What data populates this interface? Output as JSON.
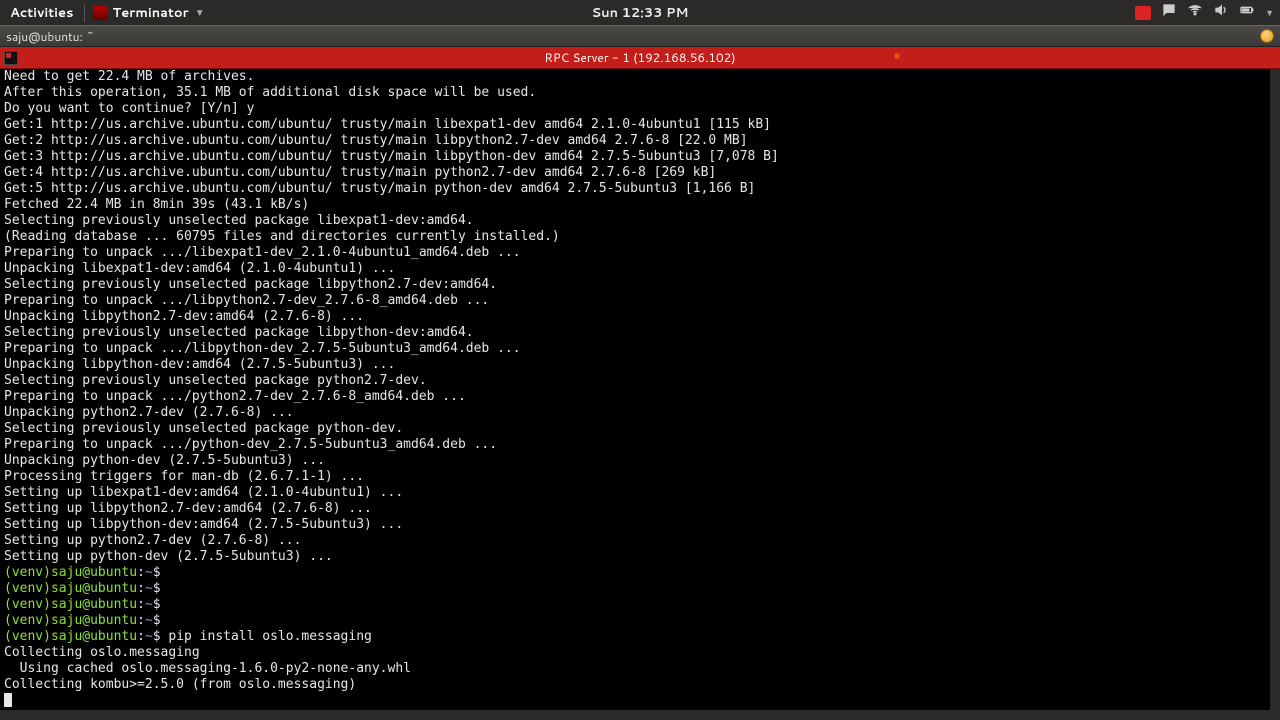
{
  "topbar": {
    "activities": "Activities",
    "app_name": "Terminator",
    "clock": "Sun 12:33 PM"
  },
  "window": {
    "title": "saju@ubuntu: ~"
  },
  "terminator_tab": {
    "title": "RPC Server - 1 (192.168.56.102)"
  },
  "prompt": {
    "venv": "(venv)",
    "userhost": "saju@ubuntu",
    "sep": ":",
    "path": "~",
    "sigil": "$"
  },
  "cmd": {
    "pip": "pip install oslo.messaging"
  },
  "lines": [
    "Need to get 22.4 MB of archives.",
    "After this operation, 35.1 MB of additional disk space will be used.",
    "Do you want to continue? [Y/n] y",
    "Get:1 http://us.archive.ubuntu.com/ubuntu/ trusty/main libexpat1-dev amd64 2.1.0-4ubuntu1 [115 kB]",
    "Get:2 http://us.archive.ubuntu.com/ubuntu/ trusty/main libpython2.7-dev amd64 2.7.6-8 [22.0 MB]",
    "Get:3 http://us.archive.ubuntu.com/ubuntu/ trusty/main libpython-dev amd64 2.7.5-5ubuntu3 [7,078 B]",
    "Get:4 http://us.archive.ubuntu.com/ubuntu/ trusty/main python2.7-dev amd64 2.7.6-8 [269 kB]",
    "Get:5 http://us.archive.ubuntu.com/ubuntu/ trusty/main python-dev amd64 2.7.5-5ubuntu3 [1,166 B]",
    "Fetched 22.4 MB in 8min 39s (43.1 kB/s)",
    "Selecting previously unselected package libexpat1-dev:amd64.",
    "(Reading database ... 60795 files and directories currently installed.)",
    "Preparing to unpack .../libexpat1-dev_2.1.0-4ubuntu1_amd64.deb ...",
    "Unpacking libexpat1-dev:amd64 (2.1.0-4ubuntu1) ...",
    "Selecting previously unselected package libpython2.7-dev:amd64.",
    "Preparing to unpack .../libpython2.7-dev_2.7.6-8_amd64.deb ...",
    "Unpacking libpython2.7-dev:amd64 (2.7.6-8) ...",
    "Selecting previously unselected package libpython-dev:amd64.",
    "Preparing to unpack .../libpython-dev_2.7.5-5ubuntu3_amd64.deb ...",
    "Unpacking libpython-dev:amd64 (2.7.5-5ubuntu3) ...",
    "Selecting previously unselected package python2.7-dev.",
    "Preparing to unpack .../python2.7-dev_2.7.6-8_amd64.deb ...",
    "Unpacking python2.7-dev (2.7.6-8) ...",
    "Selecting previously unselected package python-dev.",
    "Preparing to unpack .../python-dev_2.7.5-5ubuntu3_amd64.deb ...",
    "Unpacking python-dev (2.7.5-5ubuntu3) ...",
    "Processing triggers for man-db (2.6.7.1-1) ...",
    "Setting up libexpat1-dev:amd64 (2.1.0-4ubuntu1) ...",
    "Setting up libpython2.7-dev:amd64 (2.7.6-8) ...",
    "Setting up libpython-dev:amd64 (2.7.5-5ubuntu3) ...",
    "Setting up python2.7-dev (2.7.6-8) ...",
    "Setting up python-dev (2.7.5-5ubuntu3) ..."
  ],
  "pip_output": [
    "Collecting oslo.messaging",
    "  Using cached oslo.messaging-1.6.0-py2-none-any.whl",
    "Collecting kombu>=2.5.0 (from oslo.messaging)"
  ]
}
